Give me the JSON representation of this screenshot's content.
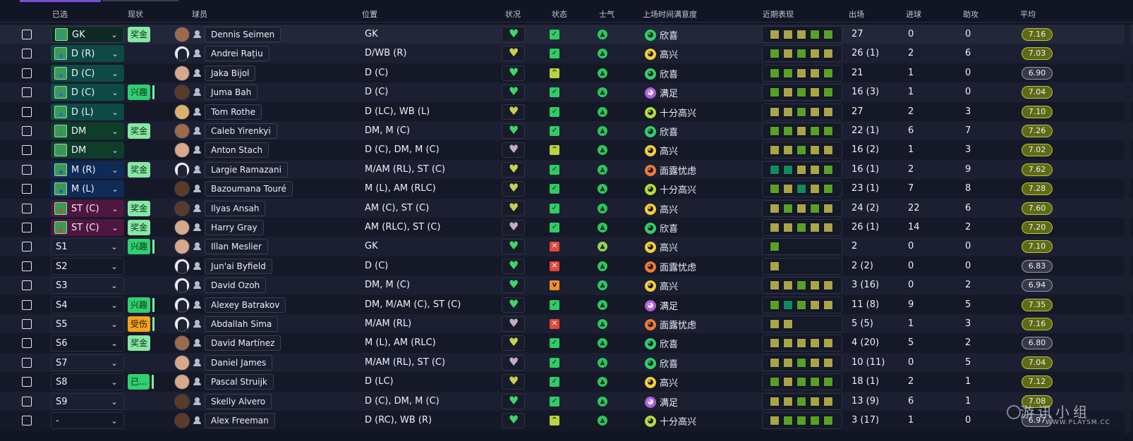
{
  "header": {
    "selected": "已选",
    "status": "现状",
    "player": "球员",
    "position": "位置",
    "condition": "状况",
    "fitness": "状态",
    "morale": "士气",
    "playtime_satisfaction": "上场时间满意度",
    "recent_form": "近期表现",
    "apps": "出场",
    "goals": "进球",
    "assists": "助攻",
    "avg": "平均"
  },
  "watermark": {
    "line1": "游讯小组",
    "line2": "WWW.PLAYSM.CC"
  },
  "colors": {
    "accent": "#7b4cd6",
    "rating_olive": "#5f6b14",
    "form_olive": "#aaa448",
    "form_green": "#58a124",
    "form_teal": "#128a5d"
  },
  "rows": [
    {
      "sel": "GK",
      "selType": "gk",
      "tag": "奖金",
      "tagStyle": "light",
      "face": "mid",
      "name": "Dennis Seimen",
      "pos": "GK",
      "cond": "g",
      "fit": "ok",
      "mor": "dk",
      "emo": "green",
      "sat": "欣喜",
      "form": [
        "o",
        "o",
        "o",
        "g",
        "g"
      ],
      "apps": "27",
      "goals": "0",
      "assists": "0",
      "avg": "7.16",
      "avgStyle": "olive"
    },
    {
      "sel": "D (R)",
      "selType": "d",
      "tag": "",
      "tagStyle": "",
      "face": "sil",
      "name": "Andrei Rațiu",
      "pos": "D/WB (R)",
      "cond": "y",
      "fit": "ok",
      "mor": "dk",
      "emo": "yellow",
      "sat": "高兴",
      "form": [
        "g",
        "o",
        "g",
        "o",
        "o"
      ],
      "apps": "26 (1)",
      "goals": "2",
      "assists": "6",
      "avg": "7.03",
      "avgStyle": "olive"
    },
    {
      "sel": "D (C)",
      "selType": "d",
      "tag": "",
      "tagStyle": "",
      "face": "light",
      "name": "Jaka Bijol",
      "pos": "D (C)",
      "cond": "g",
      "fit": "up",
      "mor": "dk",
      "emo": "green",
      "sat": "欣喜",
      "form": [
        "g",
        "g",
        "o",
        "o",
        "g"
      ],
      "apps": "21",
      "goals": "1",
      "assists": "0",
      "avg": "6.90",
      "avgStyle": "gray"
    },
    {
      "sel": "D (C)",
      "selType": "d",
      "tag": "兴趣",
      "tagStyle": "green",
      "face": "dark",
      "name": "Juma Bah",
      "pos": "D (C)",
      "cond": "g",
      "fit": "ok",
      "mor": "dk",
      "emo": "purple",
      "sat": "满足",
      "form": [
        "g",
        "o",
        "g",
        "o",
        "g"
      ],
      "apps": "16 (3)",
      "goals": "1",
      "assists": "0",
      "avg": "7.04",
      "avgStyle": "olive"
    },
    {
      "sel": "D (L)",
      "selType": "d",
      "tag": "",
      "tagStyle": "",
      "face": "blond",
      "name": "Tom Rothe",
      "pos": "D (LC), WB (L)",
      "cond": "y",
      "fit": "ok",
      "mor": "dk",
      "emo": "lime",
      "sat": "十分高兴",
      "form": [
        "o",
        "o",
        "g",
        "o",
        "o"
      ],
      "apps": "27",
      "goals": "2",
      "assists": "3",
      "avg": "7.10",
      "avgStyle": "olive"
    },
    {
      "sel": "DM",
      "selType": "dm",
      "tag": "奖金",
      "tagStyle": "light",
      "face": "mid",
      "name": "Caleb Yirenkyi",
      "pos": "DM, M (C)",
      "cond": "g",
      "fit": "ok",
      "mor": "dk",
      "emo": "green",
      "sat": "欣喜",
      "form": [
        "g",
        "g",
        "o",
        "g",
        "g"
      ],
      "apps": "22 (1)",
      "goals": "6",
      "assists": "7",
      "avg": "7.26",
      "avgStyle": "olive"
    },
    {
      "sel": "DM",
      "selType": "dm",
      "tag": "",
      "tagStyle": "",
      "face": "light",
      "name": "Anton Stach",
      "pos": "D (C), DM, M (C)",
      "cond": "p",
      "fit": "up",
      "mor": "dk",
      "emo": "yellow",
      "sat": "高兴",
      "form": [
        "o",
        "o",
        "g",
        "o",
        "o"
      ],
      "apps": "16 (2)",
      "goals": "1",
      "assists": "3",
      "avg": "7.02",
      "avgStyle": "olive"
    },
    {
      "sel": "M (R)",
      "selType": "m",
      "tag": "奖金",
      "tagStyle": "light",
      "face": "sil",
      "name": "Largie Ramazani",
      "pos": "M/AM (RL), ST (C)",
      "cond": "y",
      "fit": "ok",
      "mor": "dk",
      "emo": "orange",
      "sat": "面露忧虑",
      "form": [
        "t",
        "t",
        "o",
        "o",
        "g"
      ],
      "apps": "16 (1)",
      "goals": "2",
      "assists": "9",
      "avg": "7.62",
      "avgStyle": "olive"
    },
    {
      "sel": "M (L)",
      "selType": "m",
      "tag": "",
      "tagStyle": "",
      "face": "dark",
      "name": "Bazoumana Touré",
      "pos": "M (L), AM (RLC)",
      "cond": "y",
      "fit": "ok",
      "mor": "dk",
      "emo": "lime",
      "sat": "十分高兴",
      "form": [
        "g",
        "o",
        "t",
        "o",
        "g"
      ],
      "apps": "23 (1)",
      "goals": "7",
      "assists": "8",
      "avg": "7.28",
      "avgStyle": "olive"
    },
    {
      "sel": "ST (C)",
      "selType": "st",
      "tag": "奖金",
      "tagStyle": "light",
      "face": "dark",
      "name": "Ilyas Ansah",
      "pos": "AM (C), ST (C)",
      "cond": "y",
      "fit": "ok",
      "mor": "dk",
      "emo": "yellow",
      "sat": "高兴",
      "form": [
        "o",
        "g",
        "o",
        "g",
        "o"
      ],
      "apps": "24 (2)",
      "goals": "22",
      "assists": "6",
      "avg": "7.60",
      "avgStyle": "olive"
    },
    {
      "sel": "ST (C)",
      "selType": "st",
      "tag": "奖金",
      "tagStyle": "light",
      "face": "light",
      "name": "Harry Gray",
      "pos": "AM (RLC), ST (C)",
      "cond": "p",
      "fit": "ok",
      "mor": "dk",
      "emo": "green",
      "sat": "欣喜",
      "form": [
        "o",
        "o",
        "g",
        "o",
        "o"
      ],
      "apps": "26 (1)",
      "goals": "14",
      "assists": "2",
      "avg": "7.20",
      "avgStyle": "olive"
    },
    {
      "sel": "S1",
      "selType": "none",
      "tag": "兴趣",
      "tagStyle": "green",
      "face": "light",
      "name": "Illan Meslier",
      "pos": "GK",
      "cond": "g",
      "fit": "x",
      "mor": "lt",
      "emo": "yellow",
      "sat": "高兴",
      "form": [
        "g"
      ],
      "apps": "2",
      "goals": "0",
      "assists": "0",
      "avg": "7.10",
      "avgStyle": "olive"
    },
    {
      "sel": "S2",
      "selType": "none",
      "tag": "",
      "tagStyle": "",
      "face": "sil",
      "name": "Jun'ai Byfield",
      "pos": "D (C)",
      "cond": "g",
      "fit": "x",
      "mor": "dk",
      "emo": "orange",
      "sat": "面露忧虑",
      "form": [
        "o"
      ],
      "apps": "2 (2)",
      "goals": "0",
      "assists": "0",
      "avg": "6.83",
      "avgStyle": "gray"
    },
    {
      "sel": "S3",
      "selType": "none",
      "tag": "",
      "tagStyle": "",
      "face": "sil",
      "name": "David Ozoh",
      "pos": "DM, M (C)",
      "cond": "g",
      "fit": "dn",
      "mor": "dk",
      "emo": "yellow",
      "sat": "高兴",
      "form": [
        "o",
        "o",
        "g",
        "o",
        "o"
      ],
      "apps": "3 (16)",
      "goals": "0",
      "assists": "2",
      "avg": "6.94",
      "avgStyle": "gray"
    },
    {
      "sel": "S4",
      "selType": "none",
      "tag": "兴趣",
      "tagStyle": "green",
      "face": "sil",
      "name": "Alexey Batrakov",
      "pos": "DM, M/AM (C), ST (C)",
      "cond": "g",
      "fit": "ok",
      "mor": "dk",
      "emo": "purple",
      "sat": "满足",
      "form": [
        "g",
        "t",
        "g",
        "o",
        "o"
      ],
      "apps": "11 (8)",
      "goals": "9",
      "assists": "5",
      "avg": "7.35",
      "avgStyle": "olive"
    },
    {
      "sel": "S5",
      "selType": "none",
      "tag": "受伤",
      "tagStyle": "orange",
      "face": "sil",
      "name": "Abdallah Sima",
      "pos": "M/AM (RL)",
      "cond": "p",
      "fit": "x",
      "mor": "dk",
      "emo": "orange",
      "sat": "面露忧虑",
      "form": [
        "o",
        "o"
      ],
      "apps": "5 (5)",
      "goals": "1",
      "assists": "3",
      "avg": "7.16",
      "avgStyle": "olive"
    },
    {
      "sel": "S6",
      "selType": "none",
      "tag": "奖金",
      "tagStyle": "light",
      "face": "mid",
      "name": "David Martínez",
      "pos": "M (L), AM (RLC)",
      "cond": "y",
      "fit": "ok",
      "mor": "dk",
      "emo": "green",
      "sat": "欣喜",
      "form": [
        "o",
        "o",
        "o",
        "o",
        "o"
      ],
      "apps": "4 (20)",
      "goals": "5",
      "assists": "2",
      "avg": "6.80",
      "avgStyle": "gray"
    },
    {
      "sel": "S7",
      "selType": "none",
      "tag": "",
      "tagStyle": "",
      "face": "light",
      "name": "Daniel James",
      "pos": "M/AM (RL), ST (C)",
      "cond": "p",
      "fit": "ok",
      "mor": "dk",
      "emo": "green",
      "sat": "欣喜",
      "form": [
        "o",
        "o",
        "g",
        "o",
        "o"
      ],
      "apps": "10 (11)",
      "goals": "0",
      "assists": "5",
      "avg": "7.04",
      "avgStyle": "olive"
    },
    {
      "sel": "S8",
      "selType": "none",
      "tag": "已...",
      "tagStyle": "green",
      "face": "light",
      "name": "Pascal Struijk",
      "pos": "D (LC)",
      "cond": "y",
      "fit": "ok",
      "mor": "dk",
      "emo": "yellow",
      "sat": "高兴",
      "form": [
        "g",
        "o",
        "g",
        "g",
        "g"
      ],
      "apps": "18 (1)",
      "goals": "2",
      "assists": "1",
      "avg": "7.12",
      "avgStyle": "olive"
    },
    {
      "sel": "S9",
      "selType": "none",
      "tag": "",
      "tagStyle": "",
      "face": "dark",
      "name": "Skelly Alvero",
      "pos": "D (C), DM, M (C)",
      "cond": "g",
      "fit": "ok",
      "mor": "dk",
      "emo": "purple",
      "sat": "满足",
      "form": [
        "o",
        "o",
        "g",
        "o",
        "o"
      ],
      "apps": "13 (9)",
      "goals": "6",
      "assists": "1",
      "avg": "7.08",
      "avgStyle": "olive"
    },
    {
      "sel": "-",
      "selType": "none",
      "tag": "",
      "tagStyle": "",
      "face": "dark",
      "name": "Alex Freeman",
      "pos": "D (RC), WB (R)",
      "cond": "g",
      "fit": "up",
      "mor": "dk",
      "emo": "lime",
      "sat": "十分高兴",
      "form": [
        "o",
        "g",
        "g",
        "g",
        "g"
      ],
      "apps": "3 (17)",
      "goals": "1",
      "assists": "0",
      "avg": "6.97",
      "avgStyle": "gray"
    }
  ]
}
